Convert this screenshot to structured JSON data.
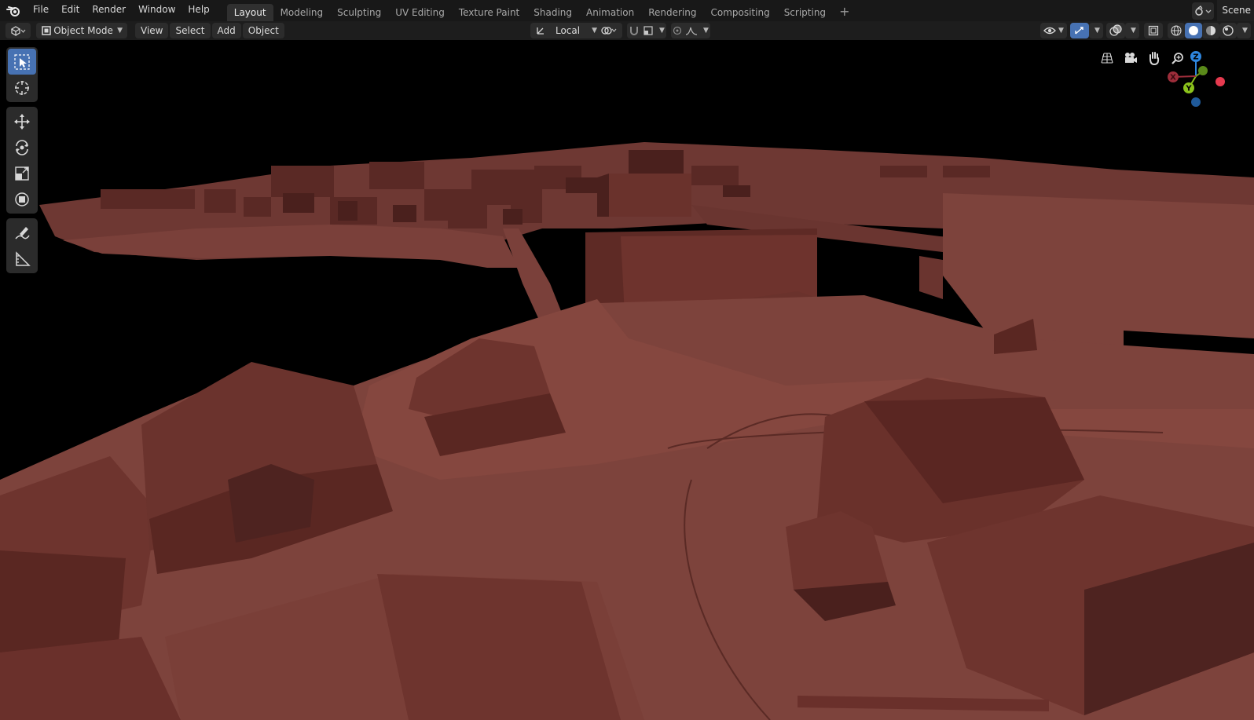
{
  "topbar": {
    "menus": [
      "File",
      "Edit",
      "Render",
      "Window",
      "Help"
    ],
    "workspaces": [
      "Layout",
      "Modeling",
      "Sculpting",
      "UV Editing",
      "Texture Paint",
      "Shading",
      "Animation",
      "Rendering",
      "Compositing",
      "Scripting"
    ],
    "active_workspace": "Layout",
    "add_workspace": "+",
    "scene_label": "Scene"
  },
  "header": {
    "mode": "Object Mode",
    "menus": [
      "View",
      "Select",
      "Add",
      "Object"
    ],
    "orientation": "Local"
  },
  "toolbar": {
    "tools": [
      "select-box",
      "cursor",
      "move",
      "rotate",
      "scale",
      "transform",
      "annotate",
      "measure"
    ],
    "active_tool": "select-box"
  },
  "gizmo": {
    "axes": {
      "x": "X",
      "y": "Y",
      "z": "Z"
    },
    "colors": {
      "x": "#e63a4f",
      "y": "#8bc21c",
      "z": "#2e86de"
    }
  },
  "viewport": {
    "background": "#000000",
    "model_color": "#7a3e38"
  }
}
